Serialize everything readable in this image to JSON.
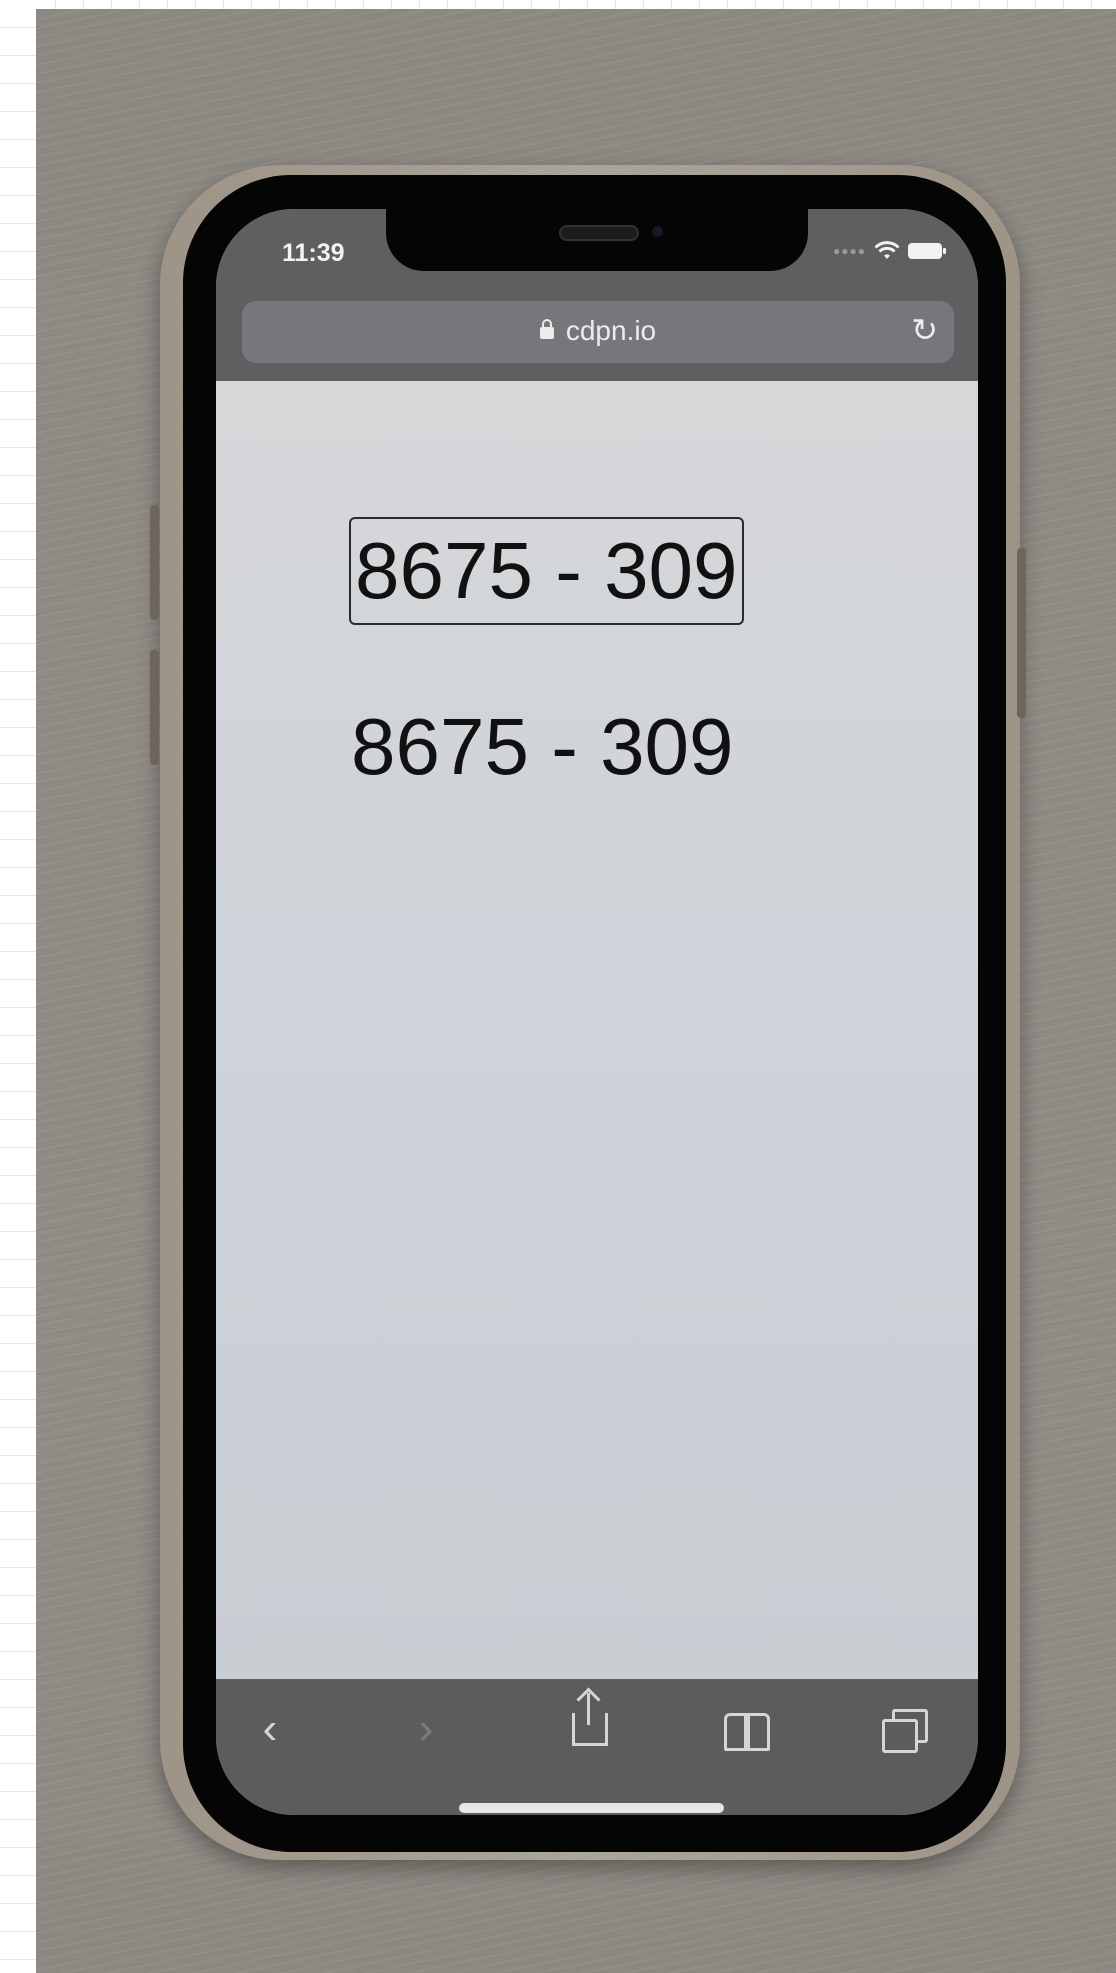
{
  "status_bar": {
    "time": "11:39"
  },
  "browser": {
    "url": "cdpn.io",
    "lock_icon": "lock-icon",
    "reload_icon": "reload-icon"
  },
  "page": {
    "input_value": "8675 - 309",
    "text_value": "8675 - 309"
  },
  "toolbar": {
    "back_icon": "chevron-left-icon",
    "forward_icon": "chevron-right-icon",
    "share_icon": "share-icon",
    "bookmarks_icon": "book-icon",
    "tabs_icon": "tabs-icon"
  },
  "colors": {
    "status_bar_bg": "#5e5f61",
    "page_bg": "#d6d7d9",
    "toolbar_bg": "#5b5c5e",
    "text": "#111111"
  }
}
